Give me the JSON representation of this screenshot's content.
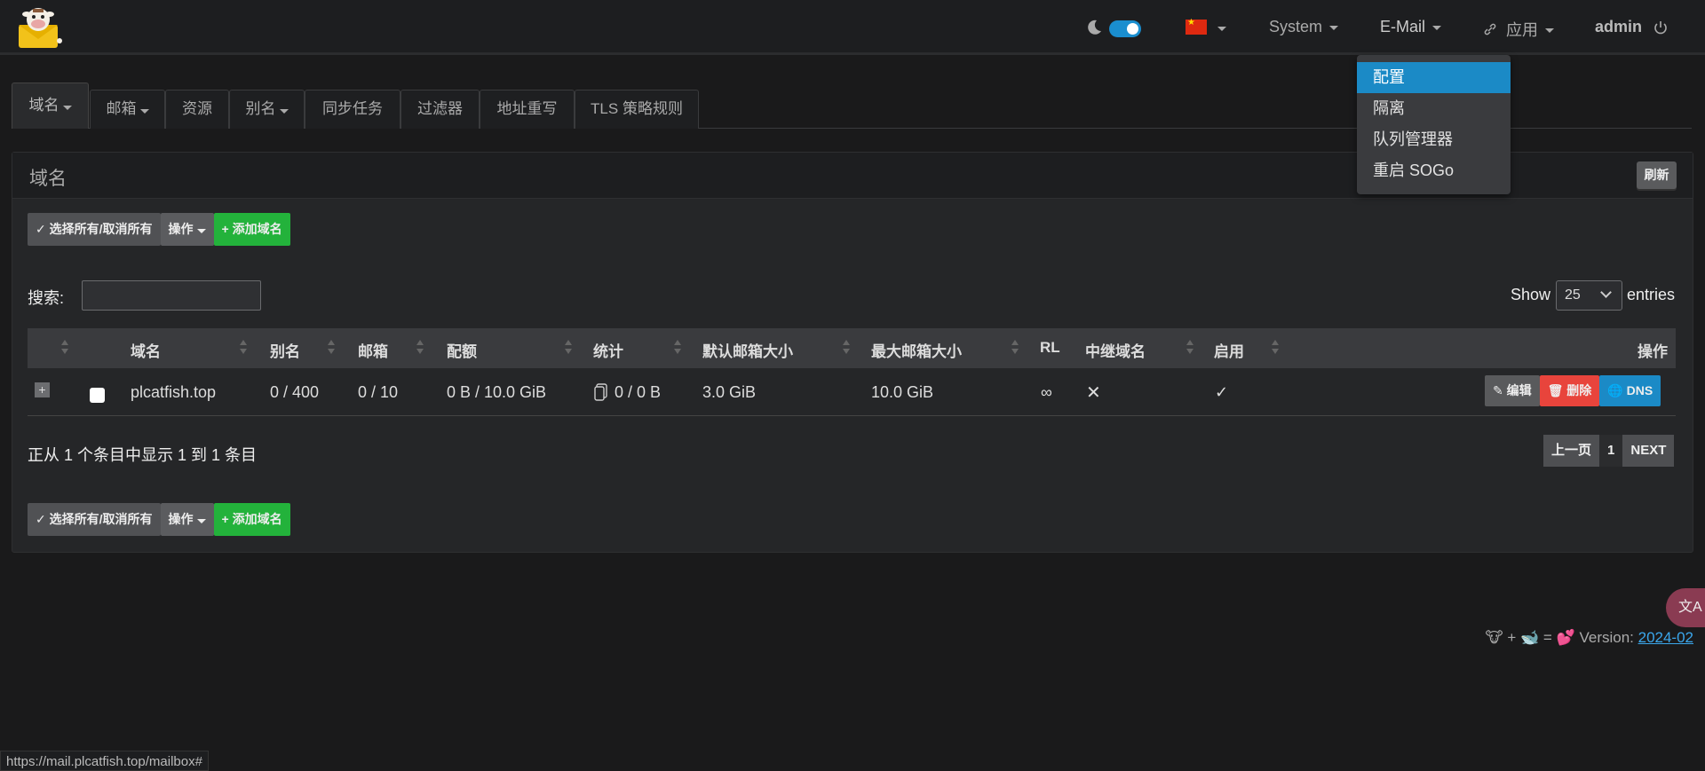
{
  "nav": {
    "system_label": "System",
    "email_label": "E-Mail",
    "apps_label": "应用",
    "user_label": "admin"
  },
  "email_menu": {
    "items": [
      {
        "label": "配置",
        "active": true
      },
      {
        "label": "隔离"
      },
      {
        "label": "队列管理器"
      },
      {
        "label": "重启 SOGo"
      }
    ]
  },
  "tabs": [
    {
      "label": "域名",
      "dropdown": true,
      "active": true
    },
    {
      "label": "邮箱",
      "dropdown": true
    },
    {
      "label": "资源"
    },
    {
      "label": "别名",
      "dropdown": true
    },
    {
      "label": "同步任务"
    },
    {
      "label": "过滤器"
    },
    {
      "label": "地址重写"
    },
    {
      "label": "TLS 策略规则"
    }
  ],
  "panel": {
    "title": "域名",
    "refresh_label": "刷新",
    "select_all_label": "选择所有/取消所有",
    "actions_label": "操作",
    "add_domain_label": "添加域名",
    "search_label": "搜索:",
    "show_label": "Show",
    "page_size": "25",
    "entries_label": "entries"
  },
  "table": {
    "headers": [
      "域名",
      "别名",
      "邮箱",
      "配额",
      "统计",
      "默认邮箱大小",
      "最大邮箱大小",
      "RL",
      "中继域名",
      "启用",
      "操作"
    ],
    "rows": [
      {
        "domain": "plcatfish.top",
        "aliases": "0 / 400",
        "mailboxes": "0 / 10",
        "quota": "0 B / 10.0 GiB",
        "stats": "0 / 0 B",
        "default_size": "3.0 GiB",
        "max_size": "10.0 GiB",
        "rl": "∞",
        "relay": "✕",
        "active": "✓",
        "edit_label": "编辑",
        "delete_label": "删除",
        "dns_label": "DNS"
      }
    ]
  },
  "table_info": "正从 1 个条目中显示 1 到 1 条目",
  "pager": {
    "prev_label": "上一页",
    "current": "1",
    "next_label": "NEXT"
  },
  "footer": {
    "prefix": "🐮 + 🐋 = 💕 Version: ",
    "version": "2024-02"
  },
  "translate_label": "文A",
  "status_url": "https://mail.plcatfish.top/mailbox#",
  "colors": {
    "accent": "#1b8ac6",
    "success": "#23b23b",
    "danger": "#e8443c"
  }
}
